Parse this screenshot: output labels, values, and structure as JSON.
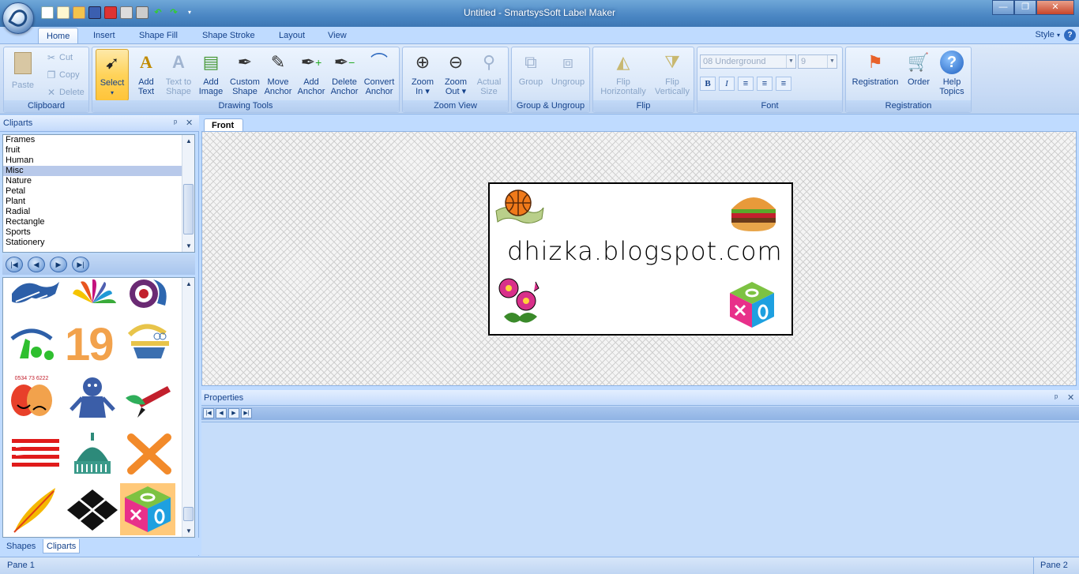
{
  "window": {
    "title": "Untitled - SmartsysSoft Label Maker"
  },
  "tabs": [
    "Home",
    "Insert",
    "Shape Fill",
    "Shape Stroke",
    "Layout",
    "View"
  ],
  "style_label": "Style",
  "help_glyph": "?",
  "ribbon": {
    "clipboard": {
      "label": "Clipboard",
      "paste": "Paste",
      "cut": "Cut",
      "copy": "Copy",
      "delete": "Delete"
    },
    "drawing_tools": {
      "label": "Drawing Tools",
      "buttons": [
        {
          "line1": "Select",
          "line2": "▾"
        },
        {
          "line1": "Add",
          "line2": "Text"
        },
        {
          "line1": "Text to",
          "line2": "Shape"
        },
        {
          "line1": "Add",
          "line2": "Image"
        },
        {
          "line1": "Custom",
          "line2": "Shape"
        },
        {
          "line1": "Move",
          "line2": "Anchor"
        },
        {
          "line1": "Add",
          "line2": "Anchor"
        },
        {
          "line1": "Delete",
          "line2": "Anchor"
        },
        {
          "line1": "Convert",
          "line2": "Anchor"
        }
      ]
    },
    "zoom_view": {
      "label": "Zoom View",
      "buttons": [
        {
          "line1": "Zoom",
          "line2": "In ▾"
        },
        {
          "line1": "Zoom",
          "line2": "Out ▾"
        },
        {
          "line1": "Actual",
          "line2": "Size"
        }
      ]
    },
    "group_ungroup": {
      "label": "Group & Ungroup",
      "group": "Group",
      "ungroup": "Ungroup"
    },
    "flip": {
      "label": "Flip",
      "buttons": [
        {
          "line1": "Flip",
          "line2": "Horizontally"
        },
        {
          "line1": "Flip",
          "line2": "Vertically"
        }
      ]
    },
    "font": {
      "label": "Font",
      "font_name": "08 Underground",
      "font_size": "9",
      "bold": "B",
      "italic": "I"
    },
    "registration": {
      "label": "Registration",
      "buttons": [
        {
          "line1": "Registration",
          "line2": ""
        },
        {
          "line1": "Order",
          "line2": ""
        },
        {
          "line1": "Help",
          "line2": "Topics"
        }
      ]
    }
  },
  "cliparts_panel": {
    "title": "Cliparts",
    "pin": "ᵖ",
    "close": "✕",
    "categories": [
      "Frames",
      "fruit",
      "Human",
      "Misc",
      "Nature",
      "Petal",
      "Plant",
      "Radial",
      "Rectangle",
      "Sports",
      "Stationery"
    ],
    "selected_category": "Misc",
    "phone_text": "0534 73 6222",
    "number_19": "19",
    "bottom_tabs": [
      "Shapes",
      "Cliparts"
    ],
    "active_bottom_tab": "Cliparts"
  },
  "document": {
    "tab": "Front",
    "label_text": "dhizka.blogspot.com"
  },
  "properties": {
    "title": "Properties"
  },
  "status": {
    "left": "Pane 1",
    "right": "Pane 2"
  },
  "colors": {
    "ribbon_text": "#15428b",
    "selected_button": "#ffd35a",
    "canvas_bg": "#f4f4f4"
  }
}
